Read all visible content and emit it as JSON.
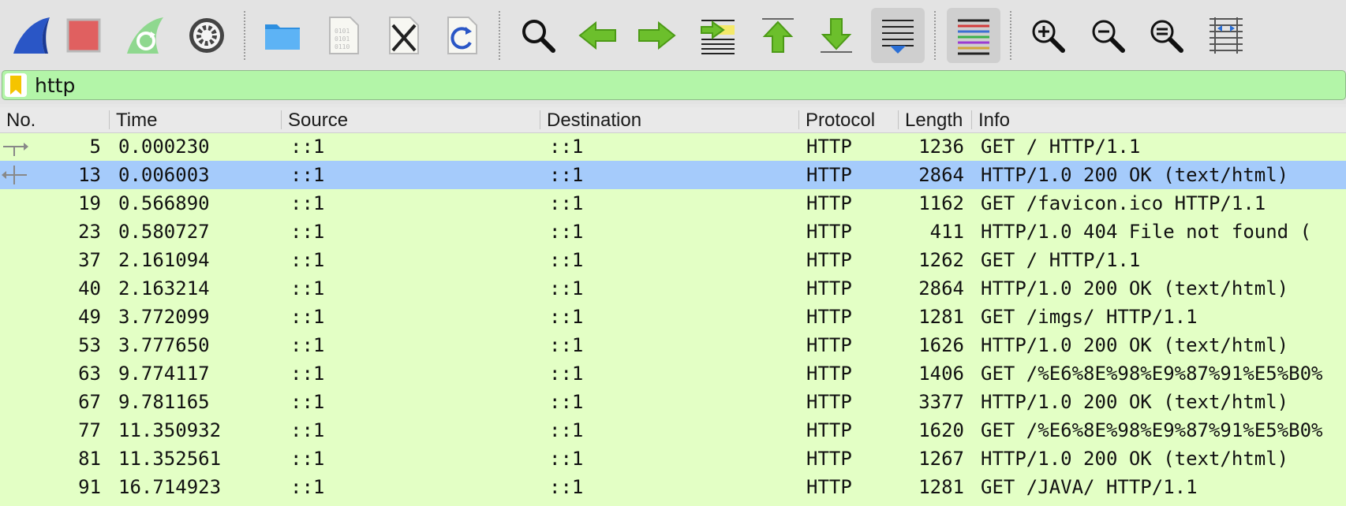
{
  "toolbar": {
    "icons": [
      "start-capture-icon",
      "stop-capture-icon",
      "restart-capture-icon",
      "capture-options-icon",
      "open-file-icon",
      "save-file-icon",
      "close-file-icon",
      "reload-file-icon",
      "find-packet-icon",
      "go-back-icon",
      "go-forward-icon",
      "go-to-packet-icon",
      "first-packet-icon",
      "last-packet-icon",
      "auto-scroll-icon",
      "colorize-icon",
      "zoom-in-icon",
      "zoom-out-icon",
      "normal-size-icon",
      "resize-columns-icon"
    ]
  },
  "filter": {
    "value": "http"
  },
  "columns": {
    "no": "No.",
    "time": "Time",
    "source": "Source",
    "destination": "Destination",
    "protocol": "Protocol",
    "length": "Length",
    "info": "Info"
  },
  "colors": {
    "row_bg": "#e3ffc5",
    "selected_bg": "#a5cbfb",
    "filter_bg": "#b3f5a8"
  },
  "packets": [
    {
      "no": "5",
      "time": "0.000230",
      "source": "::1",
      "destination": "::1",
      "protocol": "HTTP",
      "length": "1236",
      "info": "GET / HTTP/1.1",
      "selected": false,
      "relation": "request"
    },
    {
      "no": "13",
      "time": "0.006003",
      "source": "::1",
      "destination": "::1",
      "protocol": "HTTP",
      "length": "2864",
      "info": "HTTP/1.0 200 OK  (text/html)",
      "selected": true,
      "relation": "response"
    },
    {
      "no": "19",
      "time": "0.566890",
      "source": "::1",
      "destination": "::1",
      "protocol": "HTTP",
      "length": "1162",
      "info": "GET /favicon.ico HTTP/1.1",
      "selected": false,
      "relation": ""
    },
    {
      "no": "23",
      "time": "0.580727",
      "source": "::1",
      "destination": "::1",
      "protocol": "HTTP",
      "length": "411",
      "info": "HTTP/1.0 404 File not found  (",
      "selected": false,
      "relation": ""
    },
    {
      "no": "37",
      "time": "2.161094",
      "source": "::1",
      "destination": "::1",
      "protocol": "HTTP",
      "length": "1262",
      "info": "GET / HTTP/1.1",
      "selected": false,
      "relation": ""
    },
    {
      "no": "40",
      "time": "2.163214",
      "source": "::1",
      "destination": "::1",
      "protocol": "HTTP",
      "length": "2864",
      "info": "HTTP/1.0 200 OK  (text/html)",
      "selected": false,
      "relation": ""
    },
    {
      "no": "49",
      "time": "3.772099",
      "source": "::1",
      "destination": "::1",
      "protocol": "HTTP",
      "length": "1281",
      "info": "GET /imgs/ HTTP/1.1",
      "selected": false,
      "relation": ""
    },
    {
      "no": "53",
      "time": "3.777650",
      "source": "::1",
      "destination": "::1",
      "protocol": "HTTP",
      "length": "1626",
      "info": "HTTP/1.0 200 OK  (text/html)",
      "selected": false,
      "relation": ""
    },
    {
      "no": "63",
      "time": "9.774117",
      "source": "::1",
      "destination": "::1",
      "protocol": "HTTP",
      "length": "1406",
      "info": "GET /%E6%8E%98%E9%87%91%E5%B0%",
      "selected": false,
      "relation": ""
    },
    {
      "no": "67",
      "time": "9.781165",
      "source": "::1",
      "destination": "::1",
      "protocol": "HTTP",
      "length": "3377",
      "info": "HTTP/1.0 200 OK  (text/html)",
      "selected": false,
      "relation": ""
    },
    {
      "no": "77",
      "time": "11.350932",
      "source": "::1",
      "destination": "::1",
      "protocol": "HTTP",
      "length": "1620",
      "info": "GET /%E6%8E%98%E9%87%91%E5%B0%",
      "selected": false,
      "relation": ""
    },
    {
      "no": "81",
      "time": "11.352561",
      "source": "::1",
      "destination": "::1",
      "protocol": "HTTP",
      "length": "1267",
      "info": "HTTP/1.0 200 OK  (text/html)",
      "selected": false,
      "relation": ""
    },
    {
      "no": "91",
      "time": "16.714923",
      "source": "::1",
      "destination": "::1",
      "protocol": "HTTP",
      "length": "1281",
      "info": "GET /JAVA/ HTTP/1.1",
      "selected": false,
      "relation": ""
    }
  ]
}
